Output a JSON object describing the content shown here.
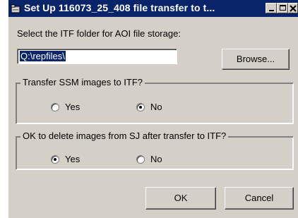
{
  "window": {
    "title": "Set Up 116073_25_408 file transfer to t...",
    "icon": "folder-transfer-icon",
    "titlebar_color": "#0a246a",
    "face_color": "#d4d0c8"
  },
  "folder_prompt": "Select the ITF folder for AOI file storage:",
  "folder_path": "Q:\\repfiles\\",
  "browse_label": "Browse...",
  "ssm_group": {
    "title": "Transfer SSM images to ITF?",
    "yes_label": "Yes",
    "no_label": "No",
    "selected": "No"
  },
  "delete_group": {
    "title": "OK to delete images from SJ after transfer to ITF?",
    "yes_label": "Yes",
    "no_label": "No",
    "selected": "Yes"
  },
  "ok_label": "OK",
  "cancel_label": "Cancel"
}
